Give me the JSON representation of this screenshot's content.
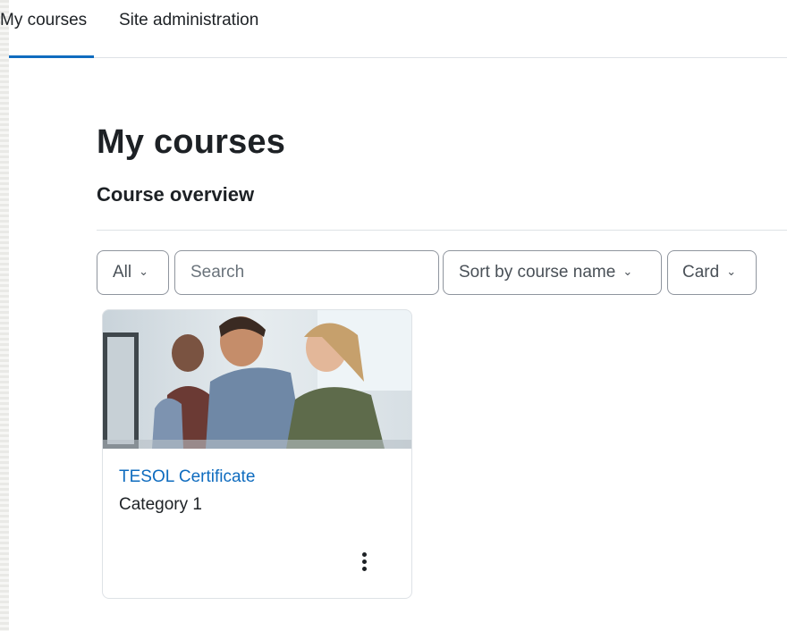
{
  "nav": {
    "tabs": [
      {
        "label": "My courses",
        "active": true
      },
      {
        "label": "Site administration",
        "active": false
      }
    ]
  },
  "main": {
    "title": "My courses",
    "section_title": "Course overview",
    "filters": {
      "grouping": "All",
      "search_placeholder": "Search",
      "sort": "Sort by course name",
      "view": "Card"
    },
    "courses": [
      {
        "name": "TESOL Certificate",
        "category": "Category 1"
      }
    ]
  },
  "colors": {
    "accent": "#0f6cbf",
    "text": "#1d2125",
    "border": "#8f959e"
  },
  "icons": {
    "dropdown": "chevron-down-icon",
    "course_menu": "three-dots-vertical-icon"
  }
}
